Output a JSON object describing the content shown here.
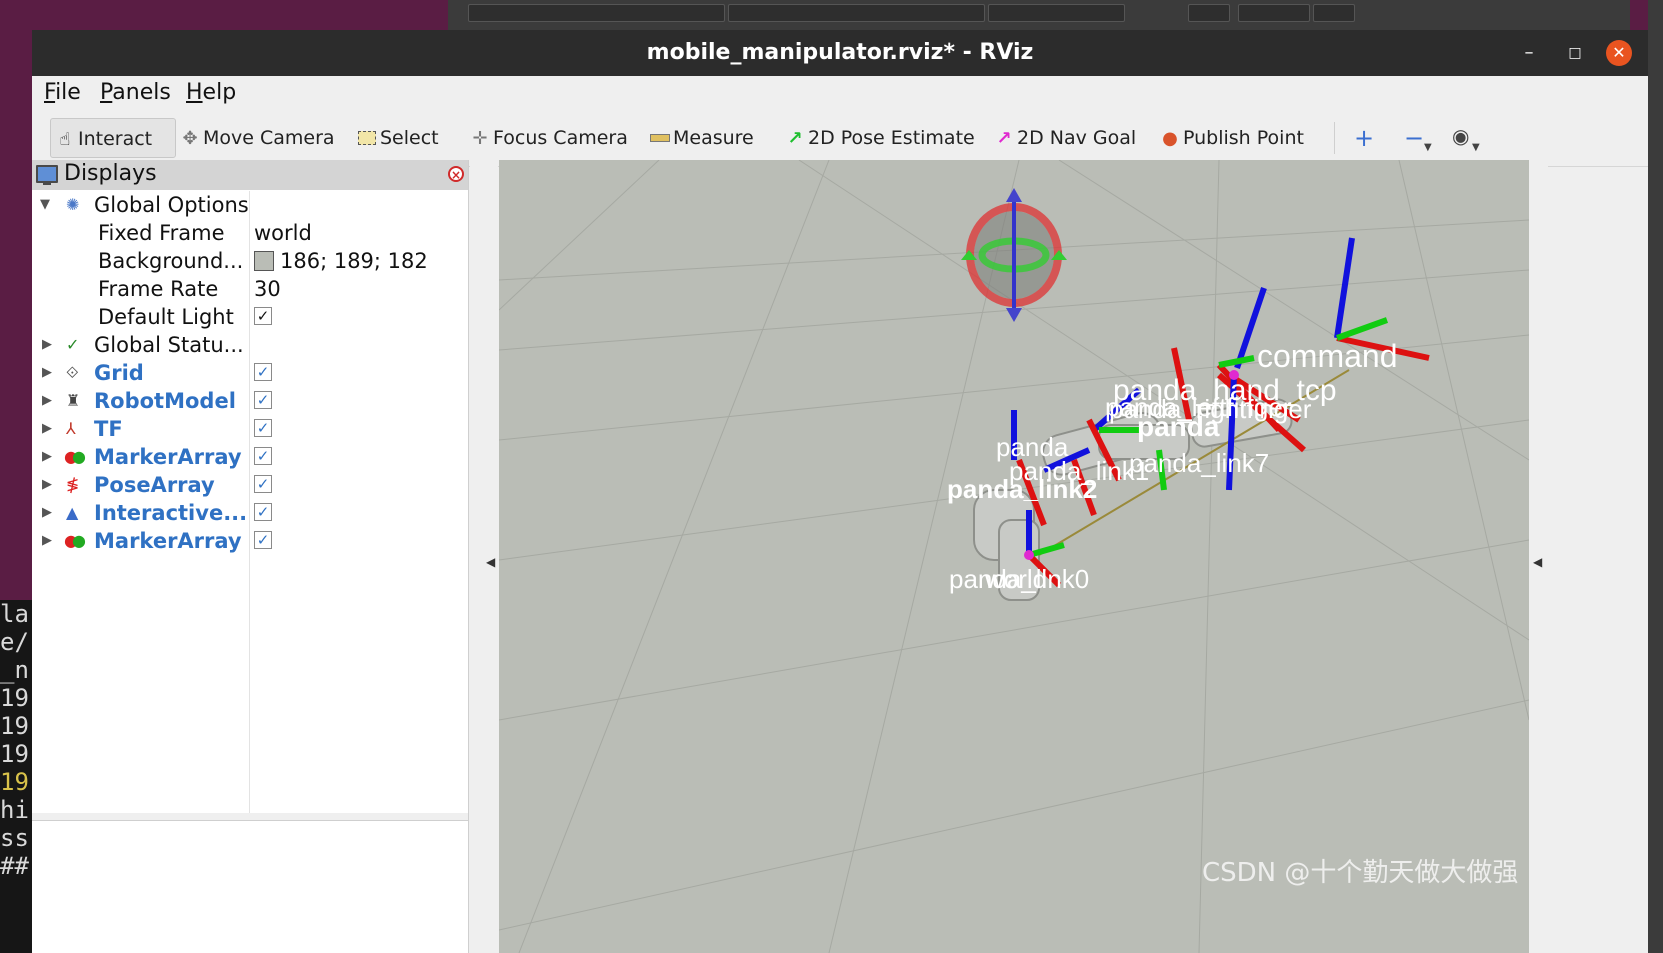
{
  "window": {
    "title": "mobile_manipulator.rviz* - RViz",
    "minimize": "–",
    "maximize": "□",
    "close": "✕"
  },
  "menu": [
    {
      "u": "F",
      "rest": "ile"
    },
    {
      "u": "P",
      "rest": "anels"
    },
    {
      "u": "H",
      "rest": "elp"
    }
  ],
  "toolbar": {
    "interact": "Interact",
    "move_camera": "Move Camera",
    "select": "Select",
    "focus_camera": "Focus Camera",
    "measure": "Measure",
    "pose_estimate": "2D Pose Estimate",
    "nav_goal": "2D Nav Goal",
    "publish_point": "Publish Point",
    "icons": [
      "hand-icon",
      "move-camera-icon",
      "select-icon",
      "focus-icon",
      "ruler-icon",
      "green-arrow-icon",
      "magenta-arrow-icon",
      "pin-icon",
      "plus-icon",
      "minus-icon",
      "eye-icon"
    ]
  },
  "displays": {
    "title": "Displays",
    "global_options": "Global Options",
    "props": [
      {
        "label": "Fixed Frame",
        "value": "world"
      },
      {
        "label": "Background...",
        "value": "186; 189; 182",
        "color": "#babdb6"
      },
      {
        "label": "Frame Rate",
        "value": "30"
      },
      {
        "label": "Default Light",
        "value": "✓"
      }
    ],
    "global_status": "Global Statu...",
    "items": [
      {
        "label": "Grid",
        "checked": "✓"
      },
      {
        "label": "RobotModel",
        "checked": "✓"
      },
      {
        "label": "TF",
        "checked": "✓"
      },
      {
        "label": "MarkerArray",
        "checked": "✓"
      },
      {
        "label": "PoseArray",
        "checked": "✓"
      },
      {
        "label": "Interactive...",
        "checked": "✓"
      },
      {
        "label": "MarkerArray",
        "checked": "✓"
      }
    ]
  },
  "viewport": {
    "background_color": "#babdb6",
    "frame_labels": [
      "command",
      "panda_hand_tcp",
      "panda_leftfinger",
      "panda_rightfinger",
      "panda",
      "panda_link7",
      "panda",
      "panda_link1",
      "panda_link2",
      "panda_link0",
      "world"
    ]
  },
  "terminal_lines": [
    "la",
    "e/",
    "_n",
    "19",
    "19",
    "19",
    "19",
    "hi",
    "ss",
    "",
    "##"
  ],
  "watermark": "CSDN @十个勤天做大做强"
}
